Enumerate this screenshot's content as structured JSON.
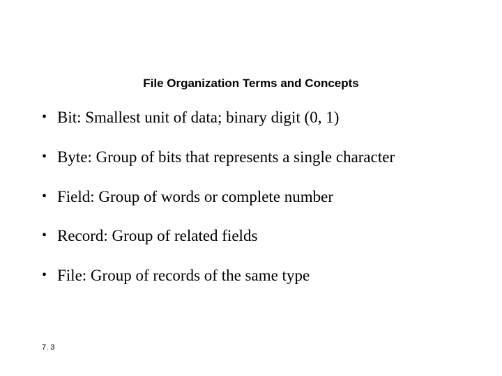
{
  "title": "File Organization Terms and Concepts",
  "bullets": [
    "Bit: Smallest unit of data; binary digit (0, 1)",
    "Byte: Group of bits that represents a single character",
    "Field: Group of words or complete number",
    "Record: Group of related fields",
    "File: Group of records of the same type"
  ],
  "page_number": "7. 3"
}
